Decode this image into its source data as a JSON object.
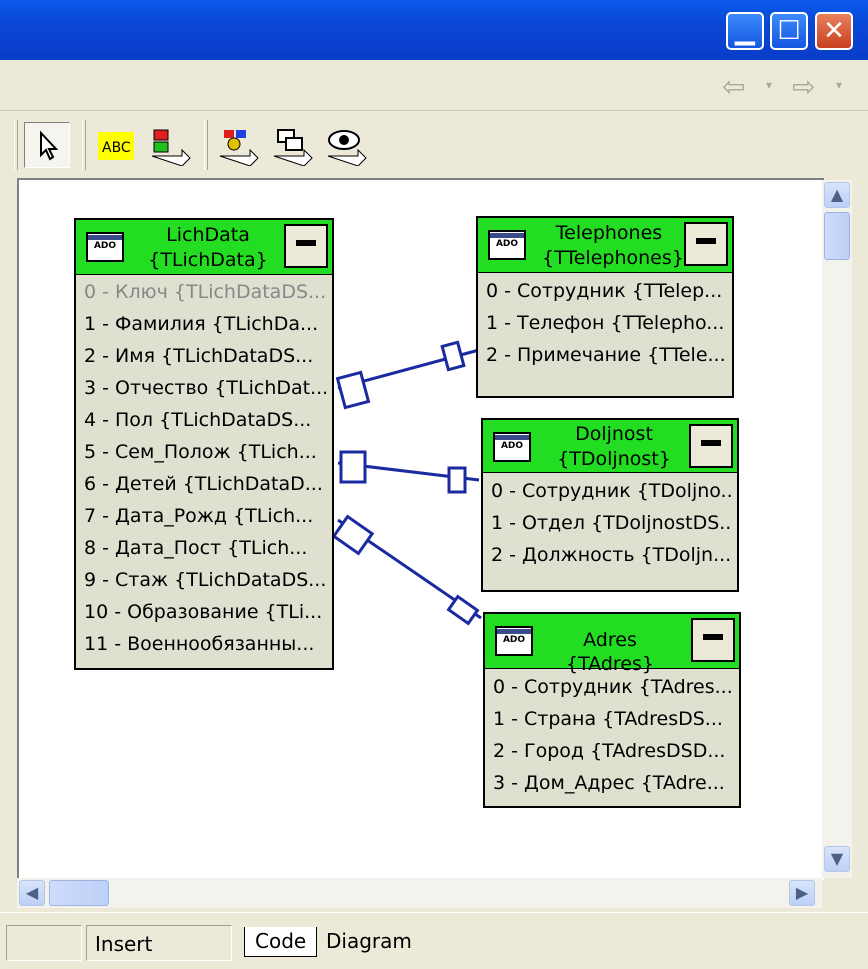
{
  "window": {
    "minimize_glyph": "▁",
    "maximize_glyph": "☐",
    "close_glyph": "✕"
  },
  "nav": {
    "back_glyph": "⇦",
    "forward_glyph": "⇨",
    "dropdown_glyph": "▾"
  },
  "toolbar": {
    "icons": [
      "pointer-icon",
      "name-field-icon",
      "property-connector-icon",
      "master-detail-connector-icon",
      "lookup-connector-icon",
      "view-icon"
    ],
    "name_field_icon_text": "ABC"
  },
  "tables": [
    {
      "title_line1": "LichData",
      "title_line2": "{TLichData}",
      "fields": [
        "0 - Ключ {TLichDataDS...",
        "1 - Фамилия {TLichDa...",
        "2 - Имя {TLichDataDS...",
        "3 - Отчество {TLichDat...",
        "4 - Пол {TLichDataDS...",
        "5 - Сем_Полож {TLich...",
        "6 - Детей {TLichDataD...",
        "7 - Дата_Рожд {TLich...",
        "8 - Дата_Пост {TLich...",
        "9 - Стаж {TLichDataDS...",
        "10 - Образование {TLi...",
        "11 - Военнообязанны..."
      ]
    },
    {
      "title_line1": "Telephones",
      "title_line2": "{TTelephones}",
      "fields": [
        "0 - Сотрудник {TTelep...",
        "1 - Телефон {TTelepho...",
        "2 - Примечание {TTele..."
      ]
    },
    {
      "title_line1": "Doljnost",
      "title_line2": "{TDoljnost}",
      "fields": [
        "0 - Сотрудник {TDoljno...",
        "1 - Отдел {TDoljnostDS...",
        "2 - Должность {TDoljn..."
      ]
    },
    {
      "title_line1": "Adres {TAdres}",
      "title_line2": "",
      "fields": [
        "0 - Сотрудник {TAdres...",
        "1 - Страна {TAdresDS...",
        "2 - Город {TAdresDSD...",
        "3 - Дом_Адрес {TAdre..."
      ]
    }
  ],
  "ado_label": "ADO",
  "scroll": {
    "up_glyph": "▲",
    "down_glyph": "▼",
    "left_glyph": "◀",
    "right_glyph": "▶"
  },
  "status": {
    "mode": "Insert",
    "tabs": [
      "Code",
      "Diagram"
    ],
    "active_tab": "Code"
  },
  "colors": {
    "header_green": "#22dd22",
    "connector_blue": "#1a2aa0",
    "titlebar_blue": "#0a46d6"
  }
}
